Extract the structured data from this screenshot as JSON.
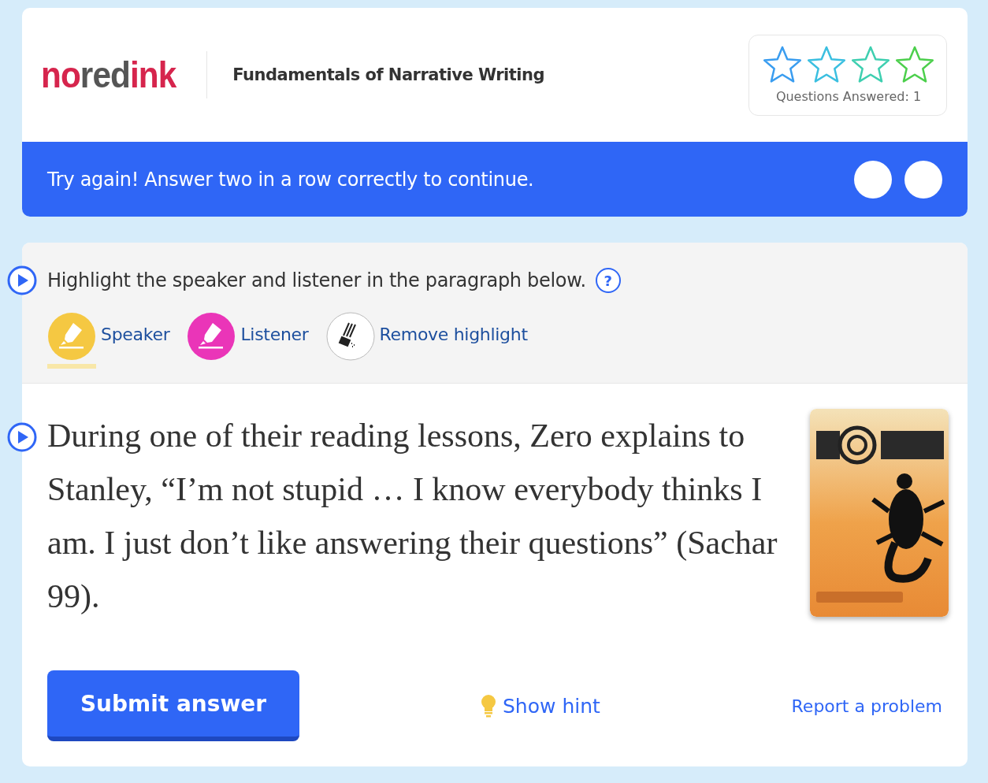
{
  "header": {
    "logo": [
      {
        "text": "no",
        "color": "#d6254d"
      },
      {
        "text": "red",
        "color": "#555555"
      },
      {
        "text": "ink",
        "color": "#d6254d"
      }
    ],
    "title": "Fundamentals of Narrative Writing",
    "progress": {
      "stars": 0,
      "label": "Questions Answered:",
      "count": "1"
    }
  },
  "banner": {
    "message": "Try again! Answer two in a row correctly to continue.",
    "attempts": [
      {
        "done": false
      },
      {
        "done": false
      }
    ]
  },
  "prompt": {
    "text": "Highlight the speaker and listener in the paragraph below.",
    "help": "?"
  },
  "tools": [
    {
      "kind": "marker",
      "label": "Speaker",
      "color": "#f5c842",
      "selected": true
    },
    {
      "kind": "marker",
      "label": "Listener",
      "color": "#ea35b8",
      "selected": false
    },
    {
      "kind": "eraser",
      "label": "Remove highlight",
      "color": "#ffffff",
      "selected": false
    }
  ],
  "passage": {
    "text": "During one of their reading lessons, Zero explains to Stanley, “I’m not stupid … I know everybody thinks I am. I just don’t like answering their questions” (Sachar 99)."
  },
  "actions": {
    "submit": "Submit answer",
    "hint": "Show hint",
    "report": "Report a problem"
  }
}
